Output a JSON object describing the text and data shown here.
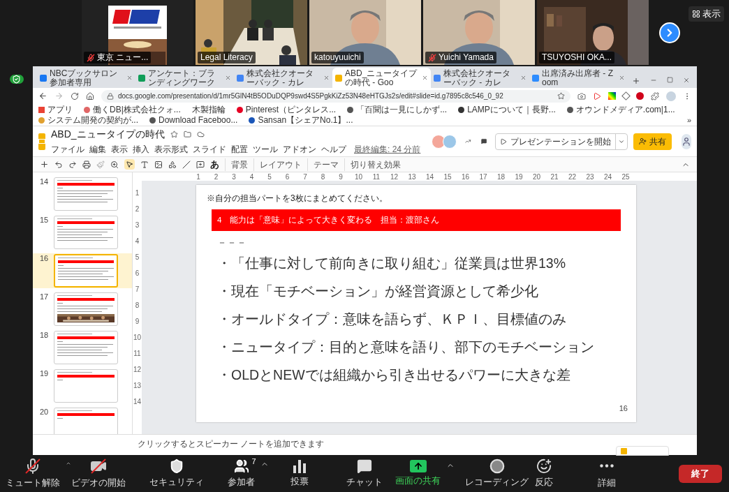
{
  "participants": [
    {
      "name": "東京 ニュー...",
      "muted": true,
      "active": false,
      "kind": "logo"
    },
    {
      "name": "Legal Literacy",
      "muted": false,
      "active": false,
      "kind": "room"
    },
    {
      "name": "katouyuuichi",
      "muted": false,
      "active": true,
      "kind": "person"
    },
    {
      "name": "Yuichi Yamada",
      "muted": true,
      "active": false,
      "kind": "person"
    },
    {
      "name": "TSUYOSHI OKA...",
      "muted": false,
      "active": false,
      "kind": "shelf"
    }
  ],
  "view_button": "表示",
  "browser": {
    "tabs": [
      {
        "title": "NBCブックサロン参加者専用",
        "kind": "facebook",
        "selected": false
      },
      {
        "title": "アンケート：ブランディングワーク",
        "kind": "sheets",
        "selected": false
      },
      {
        "title": "株式会社クオーターバック - カレ",
        "kind": "calendar",
        "selected": false
      },
      {
        "title": "ABD_ニュータイプの時代 - Goo",
        "kind": "slides",
        "selected": true
      },
      {
        "title": "株式会社クオーターバック - カレ",
        "kind": "calendar",
        "selected": false
      },
      {
        "title": "出席済み出席者 - Zoom",
        "kind": "zoom",
        "selected": false
      }
    ],
    "url": "docs.google.com/presentation/d/1mr5GlN4tB5ODuDQP9swd4S5PgkKiZz53N48eHTGJs2s/edit#slide=id.g7895c8c546_0_92",
    "bookmarks": [
      {
        "label": "アプリ",
        "kind": "apps"
      },
      {
        "label": "働くDB|株式会社クォ...",
        "kind": "db"
      },
      {
        "label": "木製指輪",
        "kind": "plain"
      },
      {
        "label": "Pinterest（ピンタレス...",
        "kind": "pinterest"
      },
      {
        "label": "「百聞は一見にしかず...",
        "kind": "globe"
      },
      {
        "label": "LAMPについて｜長野...",
        "kind": "lamp"
      },
      {
        "label": "オウンドメディア.com|1...",
        "kind": "globe"
      },
      {
        "label": "システム開発の契約が...",
        "kind": "media"
      },
      {
        "label": "Download Faceboo...",
        "kind": "globe"
      },
      {
        "label": "Sansan【シェアNo.1】...",
        "kind": "sansan"
      }
    ],
    "more_bookmarks": "»"
  },
  "doc": {
    "title": "ABD_ニュータイプの時代",
    "menu": [
      "ファイル",
      "編集",
      "表示",
      "挿入",
      "表示形式",
      "スライド",
      "配置",
      "ツール",
      "アドオン",
      "ヘルプ"
    ],
    "last_edit": "最終編集: 24 分前",
    "present_button": "プレゼンテーションを開始",
    "share_button": "共有",
    "input_tool": "あ",
    "toolbar": [
      "背景",
      "レイアウト",
      "テーマ",
      "切り替え効果"
    ]
  },
  "ruler": {
    "horizontal": [
      "1",
      "2",
      "3",
      "4",
      "5",
      "6",
      "7",
      "8",
      "9",
      "10",
      "11",
      "12",
      "13",
      "14",
      "15",
      "16",
      "17",
      "18",
      "19",
      "20",
      "21",
      "22",
      "23",
      "24",
      "25"
    ],
    "vertical": [
      "1",
      "2",
      "3",
      "4",
      "5",
      "6",
      "7",
      "8",
      "9",
      "10",
      "11",
      "12",
      "13",
      "14"
    ]
  },
  "thumbnails": [
    {
      "number": "14",
      "kind": "text",
      "selected": false
    },
    {
      "number": "15",
      "kind": "text",
      "selected": false
    },
    {
      "number": "16",
      "kind": "text",
      "selected": true
    },
    {
      "number": "17",
      "kind": "picture",
      "selected": false
    },
    {
      "number": "18",
      "kind": "text",
      "selected": false
    },
    {
      "number": "19",
      "kind": "title",
      "selected": false
    },
    {
      "number": "20",
      "kind": "title",
      "selected": false
    }
  ],
  "slide": {
    "note": "※自分の担当パートを3枚にまとめてください。",
    "header": "4　能力は「意味」によって大きく変わる　担当：渡部さん",
    "dash": "－－－",
    "bullets": [
      "・「仕事に対して前向きに取り組む」従業員は世界13%",
      "・現在「モチベーション」が経営資源として希少化",
      "・オールドタイプ：意味を語らず、ＫＰＩ、目標値のみ",
      "・ニュータイプ：目的と意味を語り、部下のモチベーション",
      "・OLDとNEWでは組織から引き出せるパワーに大きな差"
    ],
    "page": "16"
  },
  "speaker_notes": {
    "placeholder": "クリックするとスピーカー ノートを追加できます"
  },
  "zoom_toolbar": [
    {
      "label": "ミュート解除",
      "kind": "mic",
      "off": true,
      "caret": true,
      "highlight": false
    },
    {
      "label": "ビデオの開始",
      "kind": "video",
      "off": true,
      "caret": false,
      "highlight": false
    },
    {
      "label": "セキュリティ",
      "kind": "security",
      "off": false,
      "caret": false,
      "highlight": false
    },
    {
      "label": "参加者",
      "kind": "participants",
      "badge": "7",
      "off": false,
      "caret": true,
      "highlight": false
    },
    {
      "label": "投票",
      "kind": "polls",
      "off": false,
      "caret": false,
      "highlight": false
    },
    {
      "label": "チャット",
      "kind": "chat",
      "off": false,
      "caret": false,
      "highlight": false
    },
    {
      "label": "画面の共有",
      "kind": "share",
      "off": false,
      "caret": true,
      "highlight": true
    },
    {
      "label": "レコーディング",
      "kind": "record",
      "off": false,
      "caret": false,
      "highlight": false
    },
    {
      "label": "反応",
      "kind": "reactions",
      "off": false,
      "caret": false,
      "highlight": false
    },
    {
      "label": "詳細",
      "kind": "more",
      "off": false,
      "caret": false,
      "highlight": false
    }
  ],
  "end_button": "終了"
}
